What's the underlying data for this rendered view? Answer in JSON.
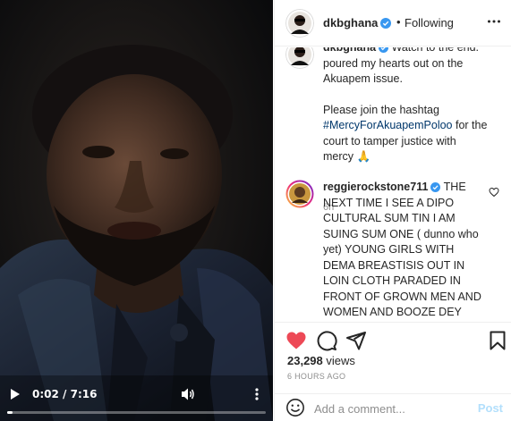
{
  "video": {
    "current_time": "0:02",
    "duration": "7:16",
    "progress_fraction": 0.005
  },
  "header": {
    "username": "dkbghana",
    "separator": "•",
    "follow_status": "Following"
  },
  "caption": {
    "username": "dkbghana",
    "text_1": " Watch to the end. poured my hearts out on the Akuapem issue.",
    "text_2": "Please join the hashtag ",
    "hashtag": "#MercyForAkuapemPoloo",
    "text_3": " for the court to tamper justice with mercy ",
    "emoji": "🙏",
    "time": "6h"
  },
  "comments": [
    {
      "username": "reggierockstone711",
      "text": " THE NEXT TIME I SEE A DIPO CULTURAL SUM TIN I AM SUING SUM ONE ( dunno who yet) YOUNG GIRLS WITH DEMA BREASTISIS OUT IN LOIN CLOTH PARADED IN FRONT OF GROWN MEN AND WOMEN AND BOOZE DEY AROUND HMMM! THIS ONE NA EEN OWN PEEKIN AND E BE PHOTO! LAWD WE ARE FUNKED!"
    }
  ],
  "stats": {
    "views_count": "23,298",
    "views_label": " views",
    "posted_ago": "6 HOURS AGO"
  },
  "add_comment": {
    "placeholder": "Add a comment...",
    "post_label": "Post"
  },
  "colors": {
    "like_red": "#ed4956",
    "verified_blue": "#3897f0",
    "link_blue": "#00376b",
    "post_disabled": "#b2dffc"
  }
}
